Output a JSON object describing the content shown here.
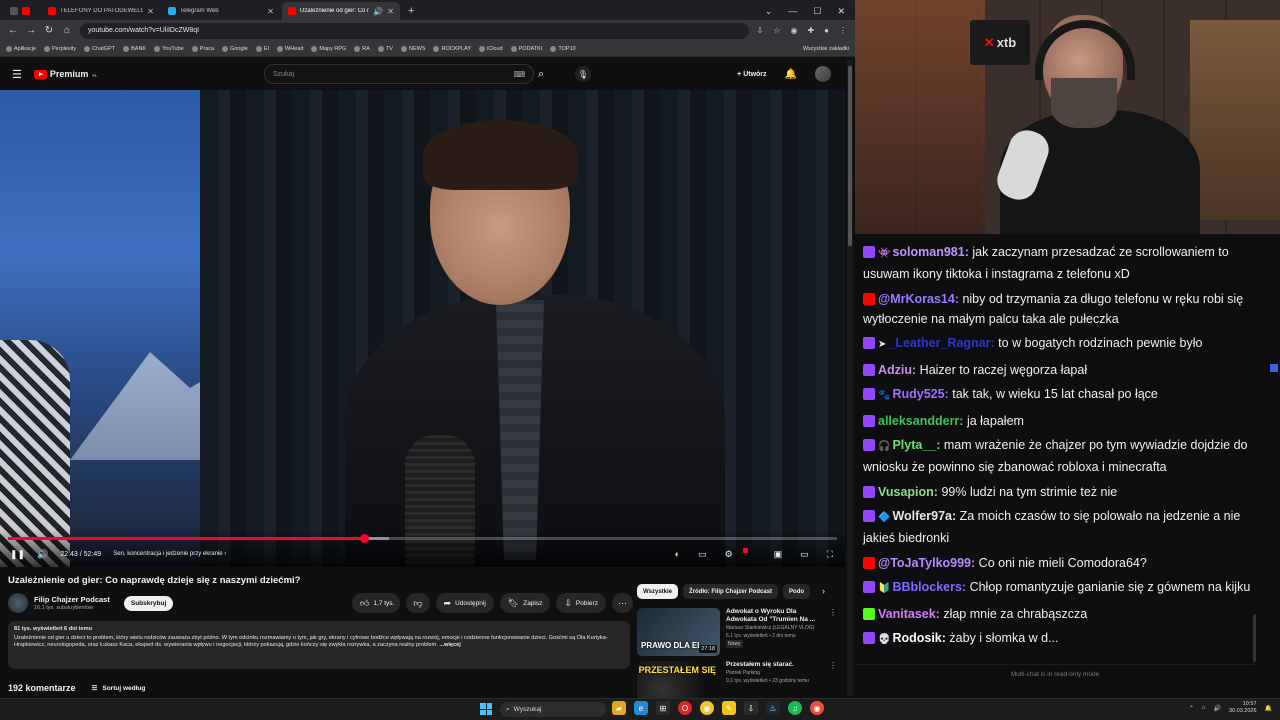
{
  "browser": {
    "tabs": [
      {
        "title": "TELEFONY DO PATODEWELOPE",
        "color": "#ff0000",
        "active": false
      },
      {
        "title": "Telegram Web",
        "color": "#2aabee",
        "active": false
      },
      {
        "title": "Uzależnienie od gier: Co na",
        "color": "#ff0000",
        "active": true
      }
    ],
    "url": "youtube.com/watch?v=UliIDcZW8qI",
    "bookmarks": [
      "Aplikacje",
      "Perplexity",
      "ChatGPT",
      "BANK",
      "YouTube",
      "Praca",
      "Google",
      "EI",
      "WHead",
      "Mapy RPG",
      "RA",
      "TV",
      "NEWS",
      "ROCKPLAY",
      "iCloud",
      "PODATKI",
      "TOP10"
    ],
    "bookmarks_right": "Wszystkie zakładki"
  },
  "yt": {
    "logo": "Premium",
    "logo_sup": "PL",
    "search_placeholder": "Szukaj",
    "create_label": "Utwórz"
  },
  "player": {
    "time": "22:43 / 52:49",
    "chapter": "Sen, koncentracja i jedzenie przy ekranie",
    "progress": 0.43,
    "buffered": 0.46
  },
  "video": {
    "title": "Uzależnienie od gier: Co naprawdę dzieje się z naszymi dziećmi?",
    "channel": "Filip Chajzer Podcast",
    "subs": "16,1 tys. subskrybentów",
    "subscribe": "Subskrybuj",
    "likes": "1,7 tys.",
    "share": "Udostępnij",
    "save": "Zapisz",
    "download": "Pobierz",
    "stats": "81 tys. wyświetleń  6 dni temu",
    "description": "Uzależnienie od gier u dzieci to problem, który wielu rodziców zauważa zbyt późno. W tym odcinku rozmawiamy o tym, jak gry, ekrany i cyfrowe bodźce wpływają na rozwój, emocje i codzienne funkcjonowanie dzieci. Gośćmi są Ola Kurtyka-Hrapkiewicz, neurologopeda, oraz Łukasz Kaca, ekspert ds. wywierania wpływu i negocjacji, którzy pokazują, gdzie kończy się zwykła rozrywka, a zaczyna realny problem.",
    "more": "...więcej",
    "comments": "192 komentarze",
    "sort": "Sortuj według"
  },
  "related": {
    "chips": [
      "Wszystkie",
      "Źródło: Filip Chajzer Podcast",
      "Podo"
    ],
    "items": [
      {
        "title": "Adwokat o Wyroku Dla Adwokata Od \"Trumien Na ...",
        "channel": "Mariusz Stankiewicz (LEGALNY VLOG)",
        "meta": "6,1 tys. wyświetleń • 2 dni temu",
        "badge": "Nowy",
        "duration": "27:18",
        "thumb_text": "PRAWO DLA EL"
      },
      {
        "title": "Przestałem się starać.",
        "channel": "Piotrek Parking",
        "meta": "9,1 tys. wyświetleń • 23 godziny temu",
        "badge": "",
        "duration": "",
        "thumb_text": "PRZESTAŁEM SIĘ"
      }
    ]
  },
  "cam": {
    "sign": "xtb"
  },
  "chat": {
    "messages": [
      {
        "platform": "tw",
        "extra": "👾",
        "user": "soloman981:",
        "color": "#bf94ff",
        "text": "jak zaczynam przesadzać ze scrollowaniem to usuwam ikony tiktoka i instagrama z telefonu xD"
      },
      {
        "platform": "yt",
        "extra": "",
        "user": "@MrKoras14:",
        "color": "#9b7bff",
        "text": "niby od trzymania za długo telefonu w ręku robi się wytłoczenie na małym palcu taka ale pułeczka"
      },
      {
        "platform": "tw",
        "extra": "➤",
        "user": "_Leather_Ragnar:",
        "color": "#2a37c9",
        "text": "to w bogatych rodzinach pewnie było"
      },
      {
        "platform": "tw",
        "extra": "",
        "user": "Adziu:",
        "color": "#c792ea",
        "text": "Haizer to raczej węgorza łapał"
      },
      {
        "platform": "tw",
        "extra": "🐾",
        "user": "Rudy525:",
        "color": "#a070ff",
        "text": "tak tak, w wieku 15 lat chasał po łące"
      },
      {
        "platform": "tw",
        "extra": "",
        "user": "alleksandderr:",
        "color": "#40c057",
        "text": "ja łapałem"
      },
      {
        "platform": "tw",
        "extra": "🎧",
        "user": "Plyta__:",
        "color": "#6ee06e",
        "text": "mam wrażenie że chajzer po tym wywiadzie dojdzie do wniosku że powinno się zbanować robloxa i minecrafta"
      },
      {
        "platform": "tw",
        "extra": "",
        "user": "Vusapion:",
        "color": "#8fd98f",
        "text": "99% ludzi na tym strimie też nie"
      },
      {
        "platform": "tw",
        "extra": "🔷",
        "user": "Wolfer97a:",
        "color": "#e8e8e8",
        "text": "Za moich czasów to się polowało na jedzenie a nie jakieś biedronki"
      },
      {
        "platform": "yt",
        "extra": "",
        "user": "@ToJaTylko999:",
        "color": "#b48cff",
        "text": "Co oni nie mieli Comodora64?"
      },
      {
        "platform": "tw",
        "extra": "🔰",
        "user": "BBblockers:",
        "color": "#7c6cff",
        "text": "Chłop romantyzuje ganianie się z gównem na kijku"
      },
      {
        "platform": "kick",
        "extra": "",
        "user": "Vanitasek:",
        "color": "#d67bff",
        "text": "złap mnie za chrabąszcza"
      },
      {
        "platform": "tw",
        "extra": "💀",
        "user": "Rodosik:",
        "color": "#ffffff",
        "text": "żaby i słomka w d..."
      }
    ],
    "footer": "Multi-chat is in read-only mode"
  },
  "taskbar": {
    "search": "Wyszukaj",
    "time": "10:57",
    "date": "30.03.2026"
  }
}
